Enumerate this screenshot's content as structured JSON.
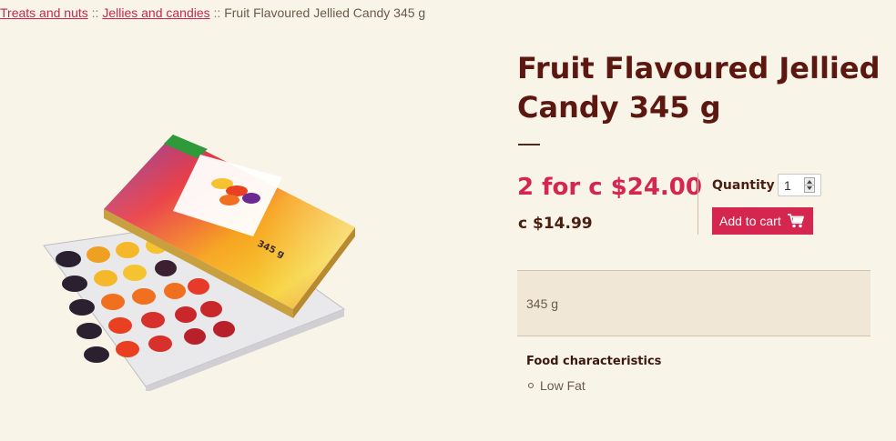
{
  "breadcrumb": {
    "items": [
      "Treats and nuts",
      "Jellies and candies"
    ],
    "separator": "::",
    "current": "Fruit Flavoured Jellied Candy 345 g"
  },
  "product": {
    "title": "Fruit Flavoured Jellied Candy 345 g",
    "promo_price": "2 for c $24.00",
    "regular_price": "c $14.99",
    "image_box_label": "345 g",
    "weight": "345 g"
  },
  "cart": {
    "quantity_label": "Quantity",
    "quantity_value": "1",
    "add_to_cart_label": "Add to cart"
  },
  "characteristics": {
    "title": "Food characteristics",
    "items": [
      "Low Fat"
    ]
  },
  "colors": {
    "background": "#f9f4e8",
    "accent": "#d5264f",
    "title": "#5c1810",
    "panel": "#f0e7d6"
  }
}
